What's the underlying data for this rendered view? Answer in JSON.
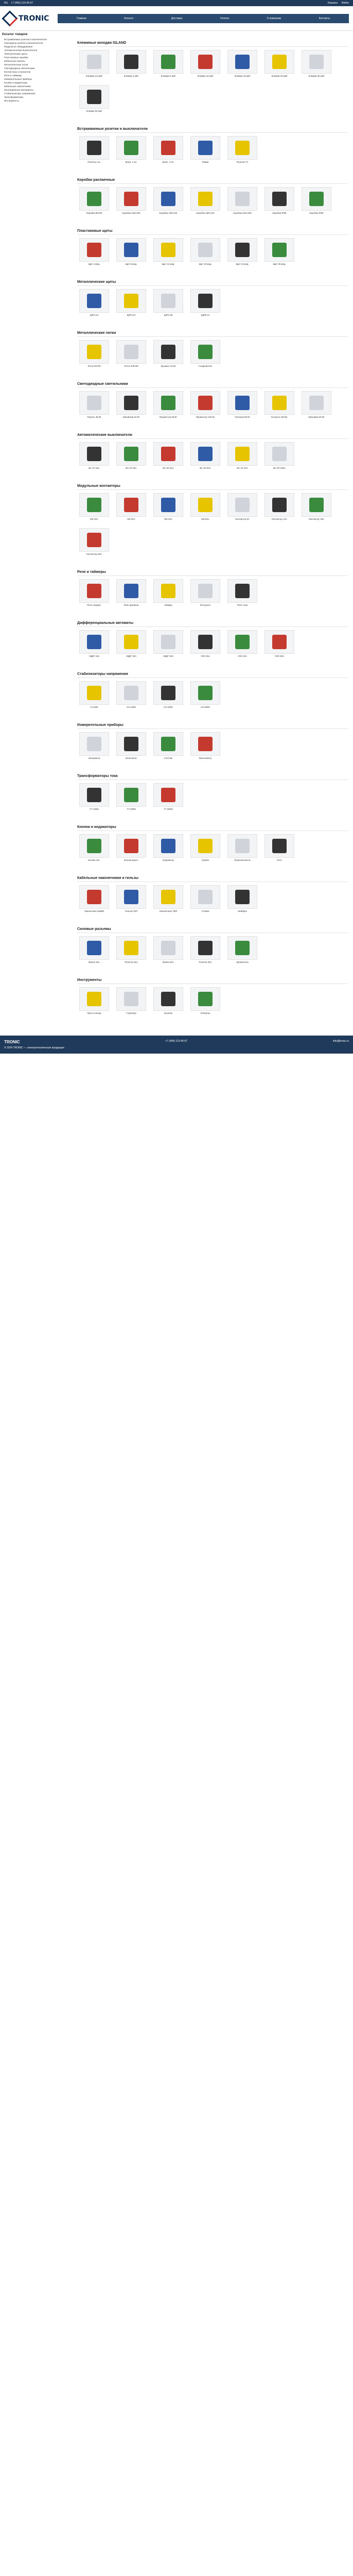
{
  "topbar": {
    "lang": "RU",
    "phone": "+7 (495) 123-45-67",
    "cart": "Корзина",
    "login": "Войти"
  },
  "brand": {
    "name": "TRONIC"
  },
  "nav": [
    "Главная",
    "Каталог",
    "Доставка",
    "Оплата",
    "О компании",
    "Контакты"
  ],
  "sidebar": {
    "title": "Каталог товаров",
    "items": [
      "Встраиваемые розетки и выключатели",
      "Накладные розетки и выключатели",
      "Модульное оборудование",
      "Автоматические выключатели",
      "Электрические щиты",
      "Пластиковые коробки",
      "Кабельные каналы",
      "Металлические лотки",
      "Светодиодные светильники",
      "Контакторы и пускатели",
      "Реле и таймеры",
      "Измерительные приборы",
      "Кнопки и индикаторы",
      "Кабельные наконечники",
      "Изоляционные материалы",
      "Стабилизаторы напряжения",
      "Трансформаторы",
      "Инструменты"
    ]
  },
  "sections": [
    {
      "title": "Клеммные колодки ISLAND",
      "cards": [
        [
          "Клемма 2,5 мм²",
          "Клемма 4 мм²",
          "Клемма 6 мм²",
          "Клемма 10 мм²",
          "Клемма 16 мм²",
          "Клемма 25 мм²",
          "Клемма 35 мм²",
          "Клемма 50 мм²"
        ]
      ]
    },
    {
      "title": "Встраиваемые розетки и выключатели",
      "cards": [
        [
          "Розетка 1-м.",
          "Выкл. 1-кл.",
          "Выкл. 2-кл.",
          "Рамка",
          "Розетка TV"
        ]
      ]
    },
    {
      "title": "Коробки распаечные",
      "cards": [
        [
          "Коробка 80×80",
          "Коробка 100×100",
          "Коробка 150×110",
          "Коробка 190×140",
          "Коробка 240×190",
          "Коробка IP55",
          "Коробка IP65"
        ]
      ]
    },
    {
      "title": "Пластиковые щиты",
      "cards": [
        [
          "Щит 4 мод.",
          "Щит 8 мод.",
          "Щит 12 мод.",
          "Щит 18 мод.",
          "Щит 24 мод.",
          "Щит 36 мод."
        ]
      ]
    },
    {
      "title": "Металлические щиты",
      "cards": [
        [
          "ЩРН-12",
          "ЩРН-24",
          "ЩРН-36",
          "ЩРВ-12"
        ]
      ]
    },
    {
      "title": "Металлические лотки",
      "cards": [
        [
          "Лоток 50×50",
          "Лоток 100×50",
          "Крышка лотка",
          "Соединитель"
        ]
      ]
    },
    {
      "title": "Светодиодные светильники",
      "cards": [
        [
          "Панель 36 Вт",
          "Линейный 18 Вт",
          "Прожектор 50 Вт",
          "Прожектор 100 Вт",
          "Уличный 60 Вт",
          "Колокол 100 Вт",
          "Трековый 20 Вт"
        ]
      ]
    },
    {
      "title": "Автоматические выключатели",
      "cards": [
        [
          "ВА 1P 16A",
          "ВА 2P 25A",
          "ВА 3P 32A",
          "ВА 4P 63A",
          "ВА 1P 10A",
          "ВА 3P 100A"
        ]
      ]
    },
    {
      "title": "Модульные контакторы",
      "cards": [
        [
          "КМ 20A",
          "КМ 25A",
          "КМ 40A",
          "КМ 63A",
          "Контактор 9A",
          "Контактор 12A",
          "Контактор 18A",
          "Контактор 25A"
        ]
      ]
    },
    {
      "title": "Реле и таймеры",
      "cards": [
        [
          "Реле напряж.",
          "Реле времени",
          "Таймер",
          "Фотореле",
          "Реле тока"
        ]
      ]
    },
    {
      "title": "Дифференциальные автоматы",
      "cards": [
        [
          "АВДТ 16А",
          "АВДТ 25А",
          "АВДТ 32А",
          "УЗО 25А",
          "УЗО 40А",
          "УЗО 63А"
        ]
      ]
    },
    {
      "title": "Стабилизаторы напряжения",
      "cards": [
        [
          "СН-500",
          "СН-1000",
          "СН-2000",
          "СН-5000"
        ]
      ]
    },
    {
      "title": "Измерительные приборы",
      "cards": [
        [
          "Амперметр",
          "Вольтметр",
          "Счетчик",
          "Мультиметр"
        ]
      ]
    },
    {
      "title": "Трансформаторы тока",
      "cards": [
        [
          "ТТ 100/5",
          "ТТ 200/5",
          "ТТ 300/5"
        ]
      ]
    },
    {
      "title": "Кнопки и индикаторы",
      "cards": [
        [
          "Кнопка зел.",
          "Кнопка красн.",
          "Индикатор",
          "Грибок",
          "Переключатель",
          "Пост"
        ]
      ]
    },
    {
      "title": "Кабельные наконечники и гильзы",
      "cards": [
        [
          "Наконечник НШВИ",
          "Гильза ГМЛ",
          "Наконечник ТМЛ",
          "Стяжки",
          "Кембрик"
        ]
      ]
    },
    {
      "title": "Силовые разъемы",
      "cards": [
        [
          "Вилка 16A",
          "Розетка 16A",
          "Вилка 32A",
          "Розетка 32A",
          "Удлинитель"
        ]
      ]
    },
    {
      "title": "Инструменты",
      "cards": [
        [
          "Пресс-клещи",
          "Стриппер",
          "Кусачки",
          "Отвертка"
        ]
      ]
    }
  ],
  "footer": {
    "copyright": "© 2024 TRONIC — электротехническая продукция",
    "phone": "+7 (495) 123-45-67",
    "email": "info@tronic.ru"
  }
}
